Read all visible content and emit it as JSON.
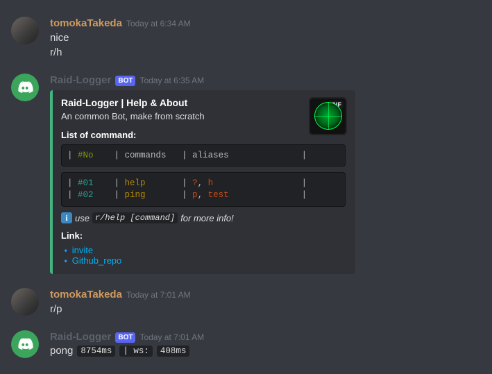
{
  "messages": {
    "m1": {
      "author": "tomokaTakeda",
      "timestamp": "Today at 6:34 AM",
      "line1": "nice",
      "line2": "r/h"
    },
    "m2": {
      "author": "Raid-Logger",
      "bot_tag": "BOT",
      "timestamp": "Today at 6:35 AM"
    },
    "m3": {
      "author": "tomokaTakeda",
      "timestamp": "Today at 7:01 AM",
      "line1": "r/p"
    },
    "m4": {
      "author": "Raid-Logger",
      "bot_tag": "BOT",
      "timestamp": "Today at 7:01 AM",
      "pong_text": "pong",
      "pong_ms": "8754ms",
      "ws_label": "| ws:",
      "ws_ms": "408ms"
    }
  },
  "embed": {
    "title": "Raid-Logger | Help & About",
    "desc": "An common Bot, make from scratch",
    "field_commands_title": "List of command:",
    "gif_tag": "GIF",
    "table_header": {
      "no": "#No",
      "cmd": "commands",
      "alias": "aliases"
    },
    "table_rows": [
      {
        "no": "#01",
        "cmd": "help",
        "alias1": "?",
        "alias2": "h"
      },
      {
        "no": "#02",
        "cmd": "ping",
        "alias1": "p",
        "alias2": "test"
      }
    ],
    "hint_prefix": "use",
    "hint_code": "r/help [command]",
    "hint_suffix": "for more info!",
    "links_title": "Link:",
    "links": {
      "invite": "invite",
      "repo": "Github_repo"
    }
  }
}
